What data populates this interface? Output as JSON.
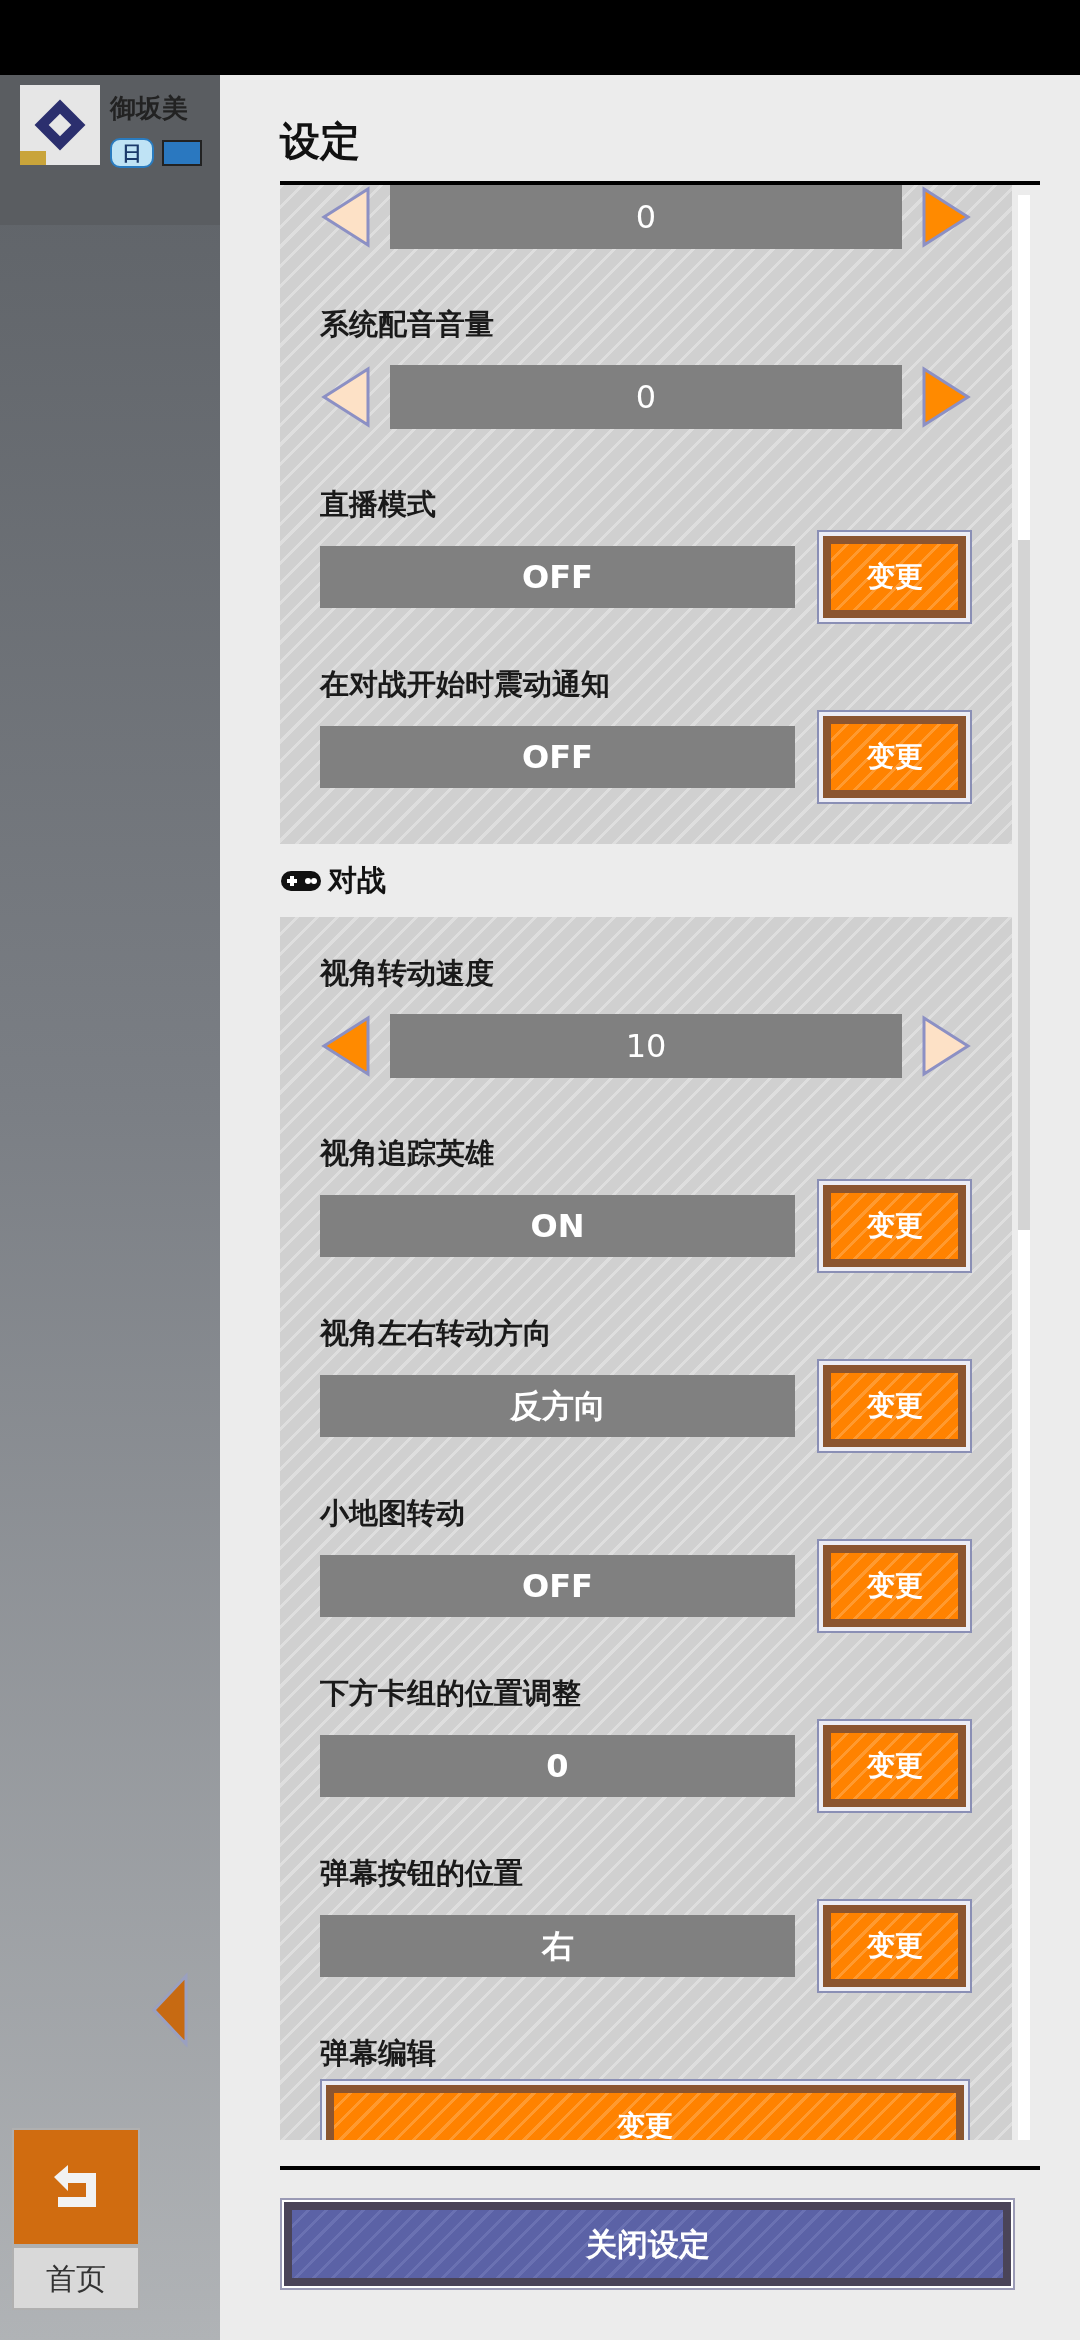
{
  "background": {
    "player_name": "御坂美",
    "rank_badge": "日",
    "home_label": "首页"
  },
  "panel": {
    "title": "设定",
    "close_label": "关闭设定"
  },
  "sections": [
    {
      "items": [
        {
          "kind": "slider",
          "value": "0",
          "decrease_disabled": true,
          "increase_disabled": false
        },
        {
          "kind": "slider",
          "label": "系统配音音量",
          "value": "0",
          "decrease_disabled": true,
          "increase_disabled": false
        },
        {
          "kind": "toggle",
          "label": "直播模式",
          "value": "OFF",
          "button": "变更"
        },
        {
          "kind": "toggle",
          "label": "在对战开始时震动通知",
          "value": "OFF",
          "button": "变更"
        }
      ]
    },
    {
      "title": "对战",
      "items": [
        {
          "kind": "slider",
          "label": "视角转动速度",
          "value": "10",
          "decrease_disabled": false,
          "increase_disabled": true
        },
        {
          "kind": "toggle",
          "label": "视角追踪英雄",
          "value": "ON",
          "button": "变更"
        },
        {
          "kind": "toggle",
          "label": "视角左右转动方向",
          "value": "反方向",
          "button": "变更"
        },
        {
          "kind": "toggle",
          "label": "小地图转动",
          "value": "OFF",
          "button": "变更"
        },
        {
          "kind": "toggle",
          "label": "下方卡组的位置调整",
          "value": "0",
          "button": "变更"
        },
        {
          "kind": "toggle",
          "label": "弹幕按钮的位置",
          "value": "右",
          "button": "变更"
        },
        {
          "kind": "action",
          "label": "弹幕编辑",
          "button": "变更"
        }
      ]
    }
  ]
}
